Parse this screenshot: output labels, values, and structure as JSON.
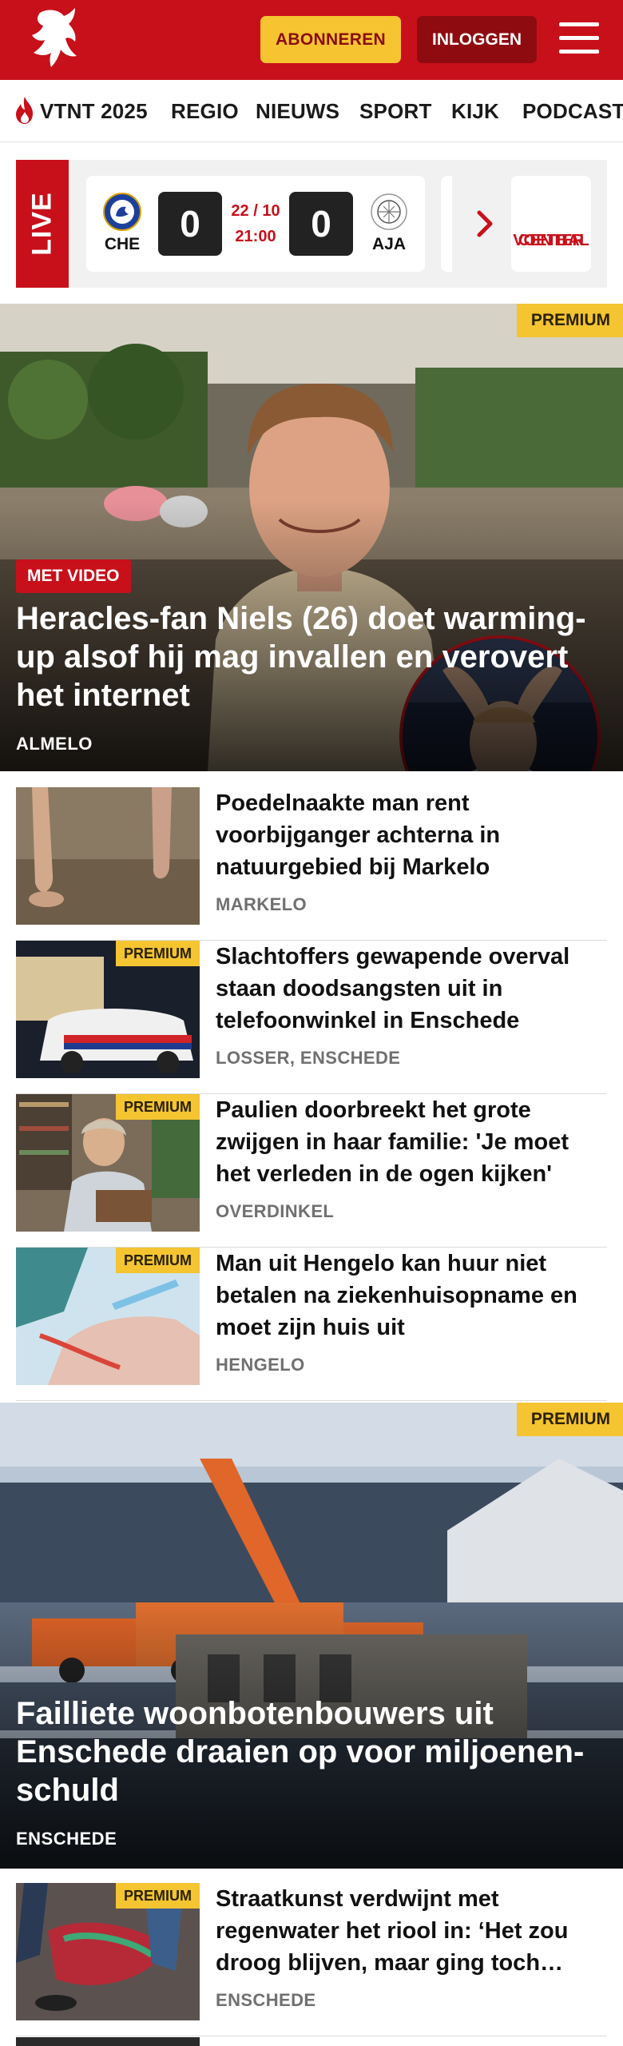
{
  "header": {
    "subscribe_label": "ABONNEREN",
    "login_label": "INLOGGEN",
    "brand_color": "#c8101a",
    "accent_yellow": "#f4c431"
  },
  "nav": {
    "items": [
      "VTNT 2025",
      "REGIO",
      "NIEUWS",
      "SPORT",
      "KIJK",
      "PODCAST"
    ]
  },
  "live": {
    "label": "LIVE",
    "match": {
      "home": "CHE",
      "away": "AJA",
      "home_score": "0",
      "away_score": "0",
      "date": "22 / 10",
      "time": "21:00"
    },
    "center_label_1": "VOETBAL",
    "center_label_2": "CENTER"
  },
  "hero1": {
    "premium": "PREMIUM",
    "badge": "MET VIDEO",
    "title": "Heracles-fan Niels (26) doet warming-up alsof hij mag invallen en verovert het internet",
    "location": "ALMELO"
  },
  "list1": [
    {
      "title": "Poedelnaakte man rent voorbijganger achterna in natuurgebied bij Markelo",
      "location": "MARKELO",
      "premium": ""
    },
    {
      "title": "Slachtoffers gewapende overval staan doodsangsten uit in telefoonwinkel in Enschede",
      "location": "LOSSER, ENSCHEDE",
      "premium": "PREMIUM"
    },
    {
      "title": "Paulien doorbreekt het grote zwijgen in haar familie: 'Je moet het verleden in de ogen kijken'",
      "location": "OVERDINKEL",
      "premium": "PREMIUM"
    },
    {
      "title": "Man uit Hengelo kan huur niet betalen na ziekenhuisopname en moet zijn huis uit",
      "location": "HENGELO",
      "premium": "PREMIUM"
    }
  ],
  "hero2": {
    "premium": "PREMIUM",
    "title": "Failliete woonbotenbouwers uit Enschede draaien op voor miljoenen-schuld",
    "location": "ENSCHEDE"
  },
  "list2": [
    {
      "title": "Straatkunst verdwijnt met regenwater het riool in: ‘Het zou droog blijven, maar ging toch…",
      "location": "ENSCHEDE",
      "premium": "PREMIUM"
    }
  ]
}
